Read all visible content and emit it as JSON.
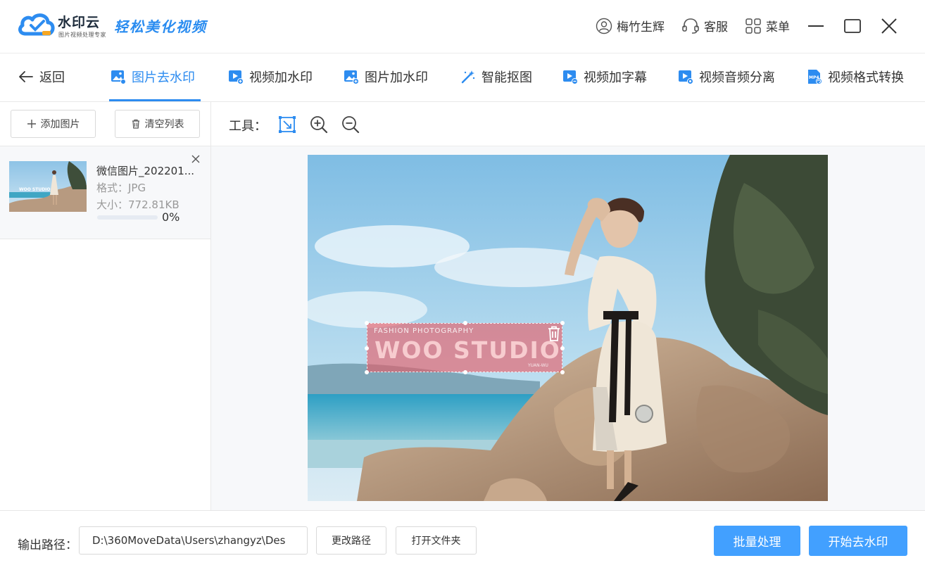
{
  "titlebar": {
    "brand_name": "水印云",
    "brand_sub": "图片视频处理专家",
    "slogan": "轻松美化视频",
    "user_name": "梅竹生辉",
    "service_label": "客服",
    "menu_label": "菜单"
  },
  "tabs": {
    "back_label": "返回",
    "items": [
      {
        "label": "图片去水印"
      },
      {
        "label": "视频加水印"
      },
      {
        "label": "图片加水印"
      },
      {
        "label": "智能抠图"
      },
      {
        "label": "视频加字幕"
      },
      {
        "label": "视频音频分离"
      },
      {
        "label": "视频格式转换"
      }
    ],
    "active_index": 0
  },
  "left_panel": {
    "add_label": "添加图片",
    "clear_label": "清空列表",
    "files": [
      {
        "name": "微信图片_202201...",
        "format": "格式：JPG",
        "size": "大小：772.81KB",
        "progress_text": "0%",
        "progress": 0
      }
    ]
  },
  "workspace": {
    "tools_label": "工具：",
    "watermark": {
      "small_text": "FASHION PHOTOGRAPHY",
      "main_text": "WOO STUDIO",
      "tiny_text": "YUAN-WU"
    },
    "thumb_watermark": "WOO STUDIO"
  },
  "footer": {
    "output_label": "输出路径：",
    "output_path": "D:\\360MoveData\\Users\\zhangyz\\Des",
    "change_path_label": "更改路径",
    "open_folder_label": "打开文件夹",
    "batch_label": "批量处理",
    "start_label": "开始去水印"
  },
  "colors": {
    "accent": "#2d8cf0",
    "primary_button": "#42a0ff",
    "watermark_fill": "#e85a64"
  }
}
